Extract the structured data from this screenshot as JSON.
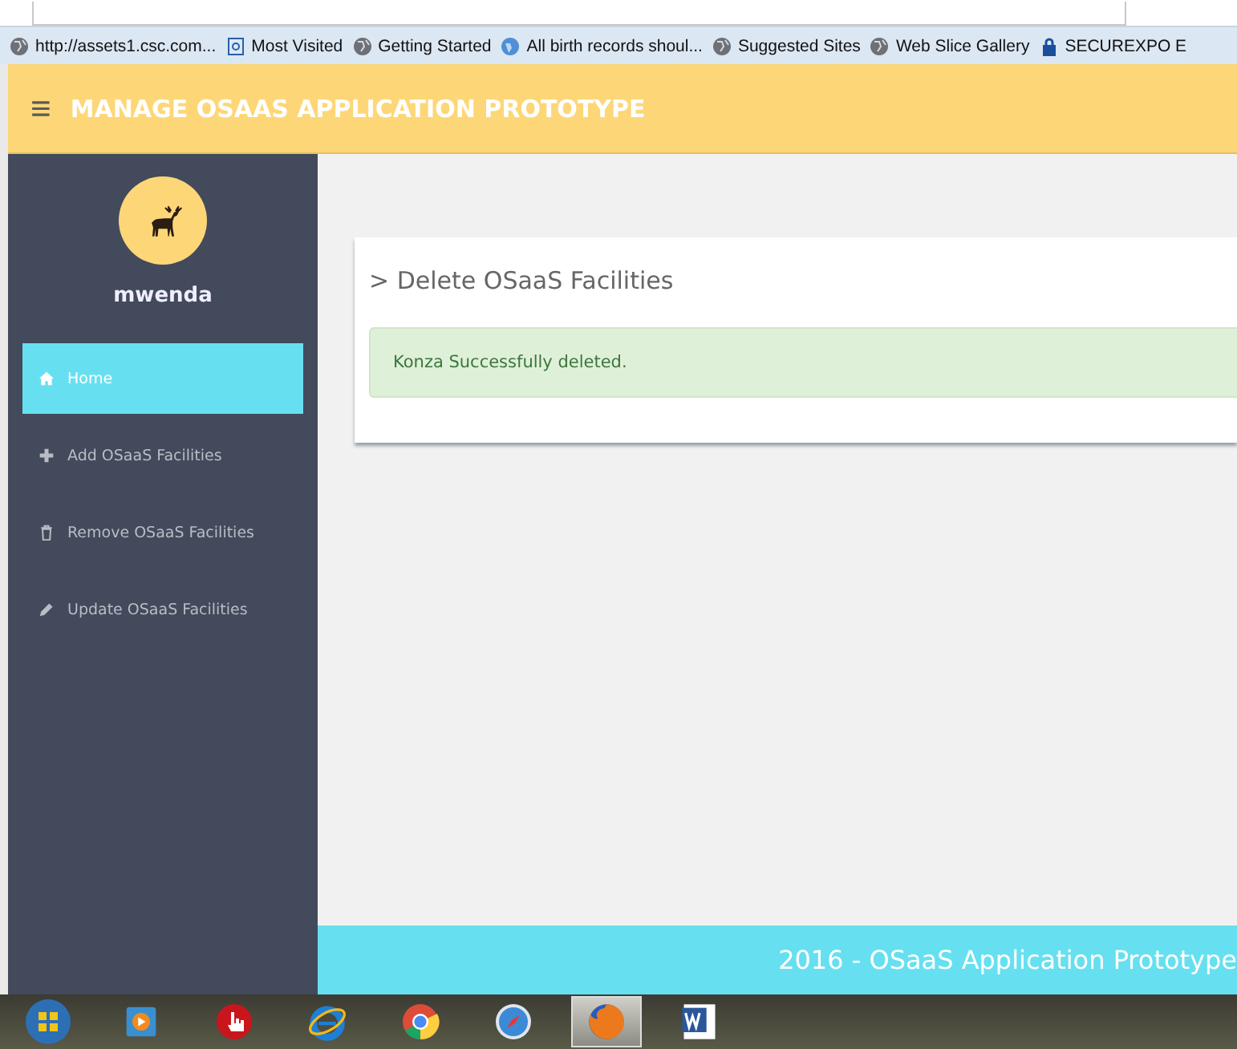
{
  "bookmarks": [
    {
      "label": "http://assets1.csc.com..."
    },
    {
      "label": "Most Visited"
    },
    {
      "label": "Getting Started"
    },
    {
      "label": "All birth records shoul..."
    },
    {
      "label": "Suggested Sites"
    },
    {
      "label": "Web Slice Gallery"
    },
    {
      "label": "SECUREXPO E"
    }
  ],
  "header": {
    "menu_icon": "≡",
    "title": "MANAGE OSAAS APPLICATION PROTOTYPE"
  },
  "sidebar": {
    "user": "mwenda",
    "items": [
      {
        "label": "Home",
        "selected": true
      },
      {
        "label": "Add OSaaS Facilities",
        "selected": false
      },
      {
        "label": "Remove OSaaS Facilities",
        "selected": false
      },
      {
        "label": "Update OSaaS Facilities",
        "selected": false
      }
    ]
  },
  "panel": {
    "title": "> Delete OSaaS Facilities",
    "alert": "Konza Successfully deleted."
  },
  "footer": "2016 - OSaaS Application Prototype",
  "taskbar": {
    "apps": [
      {
        "selected": false
      },
      {
        "selected": false
      },
      {
        "selected": false
      },
      {
        "selected": false
      },
      {
        "selected": false
      },
      {
        "selected": false
      },
      {
        "selected": true
      },
      {
        "selected": false
      }
    ]
  }
}
